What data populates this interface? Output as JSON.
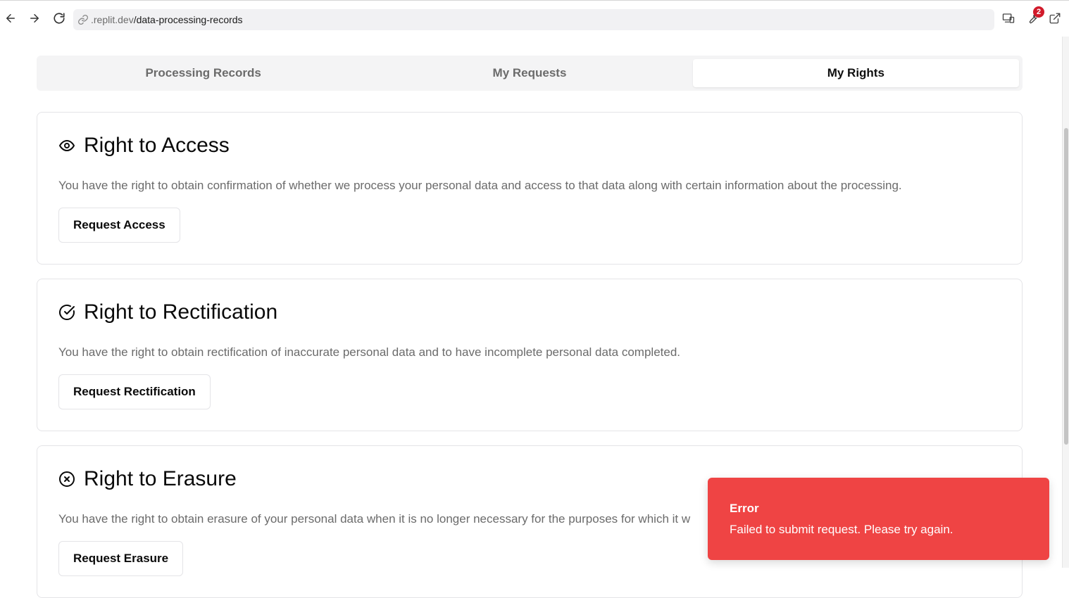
{
  "browser": {
    "url_host": ".replit.dev",
    "url_path": "/data-processing-records",
    "extensions_badge": "2"
  },
  "tabs": [
    {
      "label": "Processing Records",
      "active": false
    },
    {
      "label": "My Requests",
      "active": false
    },
    {
      "label": "My Rights",
      "active": true
    }
  ],
  "cards": [
    {
      "icon": "eye-icon",
      "title": "Right to Access",
      "description": "You have the right to obtain confirmation of whether we process your personal data and access to that data along with certain information about the processing.",
      "button": "Request Access"
    },
    {
      "icon": "circle-check-icon",
      "title": "Right to Rectification",
      "description": "You have the right to obtain rectification of inaccurate personal data and to have incomplete personal data completed.",
      "button": "Request Rectification"
    },
    {
      "icon": "circle-x-icon",
      "title": "Right to Erasure",
      "description": "You have the right to obtain erasure of your personal data when it is no longer necessary for the purposes for which it w",
      "button": "Request Erasure"
    }
  ],
  "toast": {
    "title": "Error",
    "message": "Failed to submit request. Please try again.",
    "color": "#ef4444"
  }
}
